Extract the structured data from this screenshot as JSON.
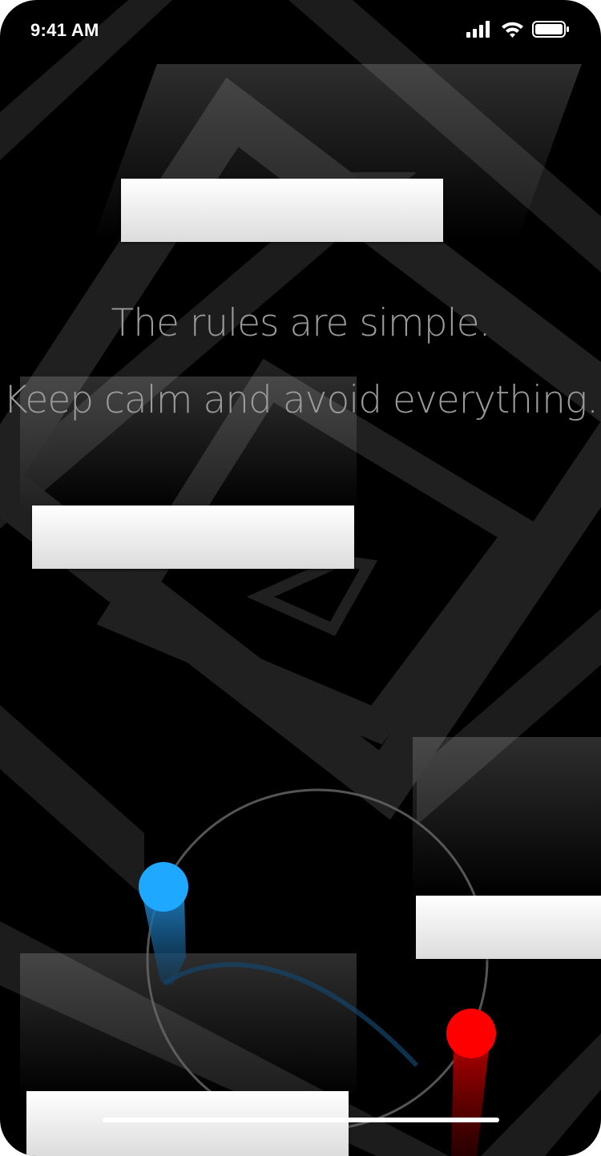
{
  "status_bar": {
    "time": "9:41 AM",
    "icons": [
      "signal-icon",
      "wifi-icon",
      "battery-icon"
    ]
  },
  "rules": {
    "line1": "The rules are simple.",
    "line2": "Keep calm and avoid everything."
  },
  "player": {
    "blue_color": "#1ea8ff",
    "red_color": "#ff0000"
  },
  "colors": {
    "background": "#000000",
    "stripe": "#1c1c1c",
    "obstacle": "#e8e8e8",
    "text": "#9a9a9a"
  }
}
